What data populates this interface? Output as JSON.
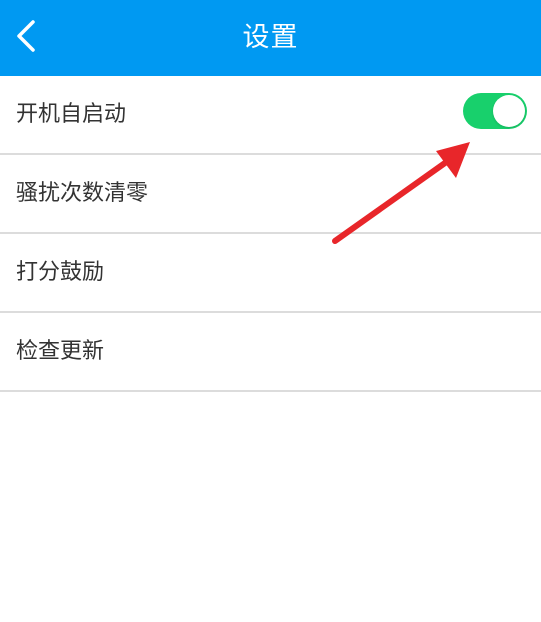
{
  "header": {
    "title": "设置",
    "back_icon": "chevron-left-icon",
    "background": "#0099f2"
  },
  "settings": {
    "items": [
      {
        "label": "开机自启动",
        "toggle": {
          "on": true,
          "color": "#18d06c"
        }
      },
      {
        "label": "骚扰次数清零"
      },
      {
        "label": "打分鼓励"
      },
      {
        "label": "检查更新"
      }
    ]
  },
  "annotation": {
    "type": "red-arrow",
    "color": "#e8262a"
  }
}
